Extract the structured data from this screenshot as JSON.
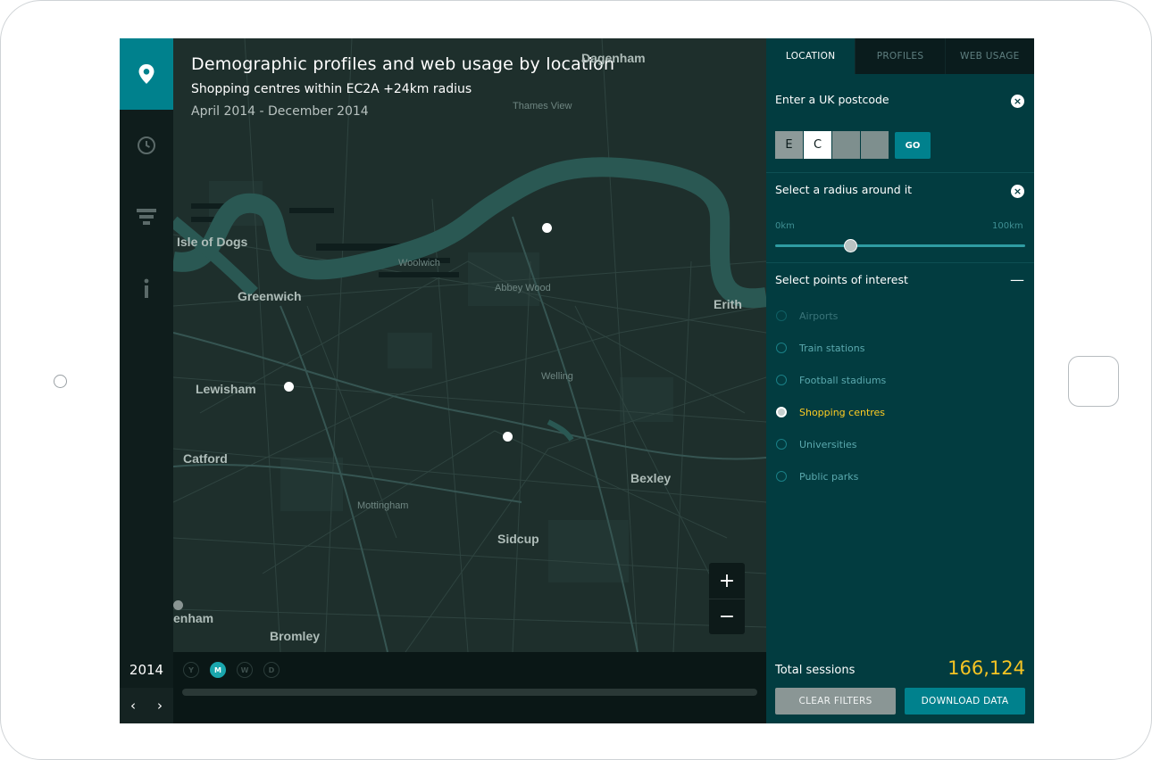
{
  "map": {
    "title": "Demographic profiles and web usage by location",
    "subtitle": "Shopping centres within EC2A +24km radius",
    "date_range": "April 2014 - December 2014",
    "places": {
      "dagenham": "Dagenham",
      "isle_of_dogs": "Isle of Dogs",
      "greenwich": "Greenwich",
      "lewisham": "Lewisham",
      "catford": "Catford",
      "bexley": "Bexley",
      "sidcup": "Sidcup",
      "bromley": "Bromley",
      "erith": "Erith",
      "enham": "enham",
      "mottingham": "Mottingham",
      "welling": "Welling",
      "woolwich": "Woolwich",
      "abbey_wood": "Abbey Wood",
      "thames_view": "Thames View"
    },
    "zoom_in": "+",
    "zoom_out": "−"
  },
  "timeline": {
    "year": "2014",
    "prev": "‹",
    "next": "›",
    "granularity": [
      "Y",
      "M",
      "W",
      "D"
    ],
    "active_granularity": "M"
  },
  "panel": {
    "tabs": [
      "LOCATION",
      "PROFILES",
      "WEB USAGE"
    ],
    "active_tab": "LOCATION",
    "postcode_title": "Enter a UK postcode",
    "postcode_chars": [
      "E",
      "C",
      "",
      ""
    ],
    "go_label": "GO",
    "radius_title": "Select a radius around it",
    "radius_min": "0km",
    "radius_max": "100km",
    "radius_value_fraction": 0.3,
    "poi_title": "Select points of interest",
    "poi_collapse": "—",
    "poi_items": [
      {
        "label": "Airports",
        "state": "disabled"
      },
      {
        "label": "Train stations",
        "state": "unchecked"
      },
      {
        "label": "Football stadiums",
        "state": "unchecked"
      },
      {
        "label": "Shopping centres",
        "state": "checked"
      },
      {
        "label": "Universities",
        "state": "unchecked"
      },
      {
        "label": "Public parks",
        "state": "unchecked"
      }
    ],
    "total_label": "Total sessions",
    "total_value": "166,124",
    "clear_label": "CLEAR FILTERS",
    "download_label": "DOWNLOAD DATA"
  },
  "colors": {
    "accent": "#00818d",
    "panel_bg": "#023c40",
    "map_bg": "#1e2f2c",
    "highlight": "#ffcc22",
    "total_value": "#f6c423"
  },
  "icons": {
    "rail": [
      "location-pin-icon",
      "clock-icon",
      "filter-icon",
      "info-icon"
    ],
    "close": "close-icon",
    "collapse": "minus-icon"
  }
}
